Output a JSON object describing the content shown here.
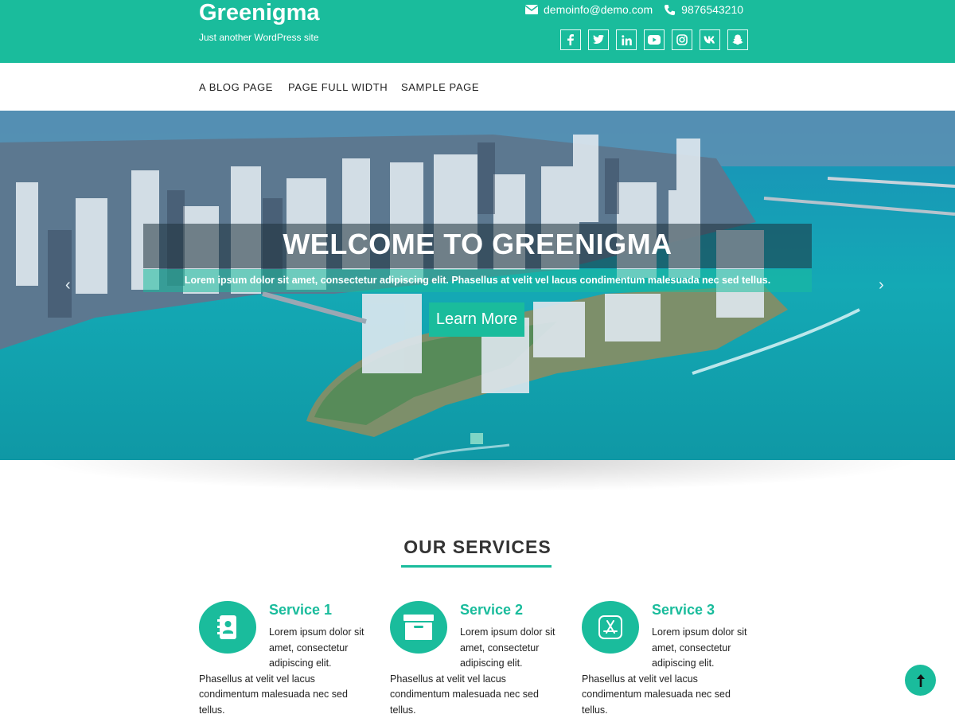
{
  "header": {
    "site_title": "Greenigma",
    "tagline": "Just another WordPress site",
    "email": "demoinfo@demo.com",
    "phone": "9876543210",
    "socials": [
      "facebook",
      "twitter",
      "linkedin",
      "youtube",
      "instagram",
      "vk",
      "snapchat"
    ]
  },
  "nav": {
    "items": [
      "A BLOG PAGE",
      "PAGE FULL WIDTH",
      "SAMPLE PAGE"
    ]
  },
  "hero": {
    "title": "WELCOME TO GREENIGMA",
    "subtitle": "Lorem ipsum dolor sit amet, consectetur adipiscing elit. Phasellus at velit vel lacus condimentum malesuada nec sed tellus.",
    "button_label": "Learn More",
    "prev_arrow": "‹",
    "next_arrow": "›"
  },
  "services": {
    "heading": "OUR SERVICES",
    "items": [
      {
        "title": "Service 1",
        "text": "Lorem ipsum dolor sit amet, consectetur adipiscing elit. Phasellus at velit vel lacus condimentum malesuada nec sed tellus.",
        "icon": "address-book-icon"
      },
      {
        "title": "Service 2",
        "text": "Lorem ipsum dolor sit amet, consectetur adipiscing elit. Phasellus at velit vel lacus condimentum malesuada nec sed tellus.",
        "icon": "archive-box-icon"
      },
      {
        "title": "Service 3",
        "text": "Lorem ipsum dolor sit amet, consectetur adipiscing elit. Phasellus at velit vel lacus condimentum malesuada nec sed tellus.",
        "icon": "app-store-icon"
      }
    ]
  },
  "colors": {
    "accent": "#1abc9c",
    "text": "#333333"
  }
}
